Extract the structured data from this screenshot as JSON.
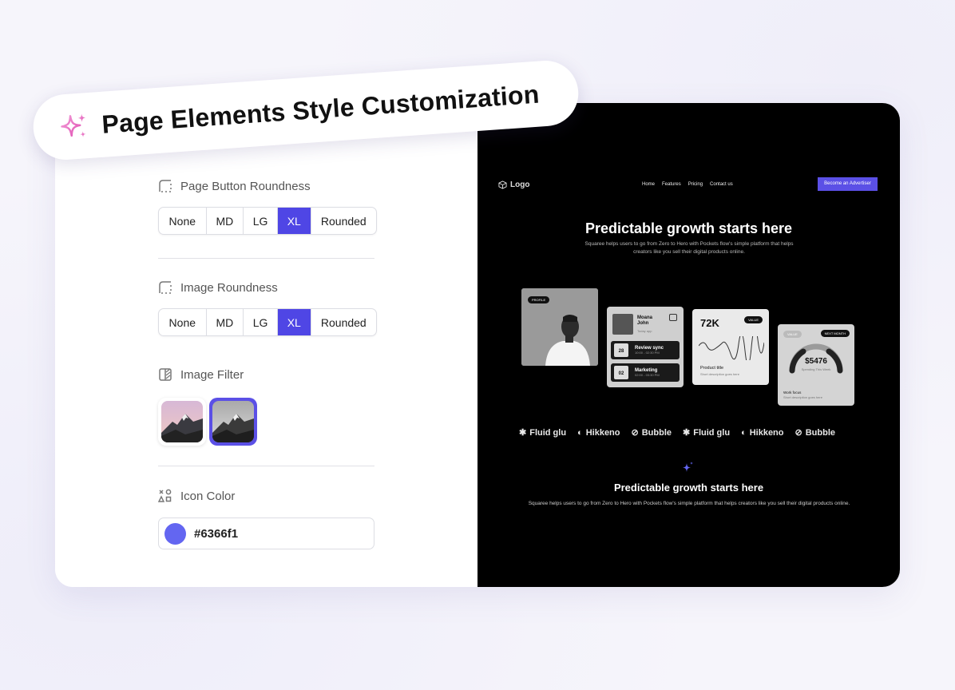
{
  "header": {
    "title": "Page Elements Style Customization",
    "icon": "sparkle-icon"
  },
  "settings": {
    "button_roundness": {
      "label": "Page Button Roundness",
      "options": [
        "None",
        "MD",
        "LG",
        "XL",
        "Rounded"
      ],
      "selected": "XL"
    },
    "image_roundness": {
      "label": "Image Roundness",
      "options": [
        "None",
        "MD",
        "LG",
        "XL",
        "Rounded"
      ],
      "selected": "XL"
    },
    "image_filter": {
      "label": "Image Filter",
      "options": [
        "color",
        "grayscale"
      ],
      "selected": "grayscale"
    },
    "icon_color": {
      "label": "Icon Color",
      "value": "#6366f1"
    }
  },
  "preview": {
    "logo": "Logo",
    "nav_links": [
      "Home",
      "Features",
      "Pricing",
      "Contact us"
    ],
    "cta": "Become an Advertiser",
    "hero_title": "Predictable growth starts here",
    "hero_sub": "Squaree helps users to go from Zero to Hero with Pockets flow's simple platform that helps creators like you sell their digital products online.",
    "profile_tag": "PROFILE",
    "schedule": {
      "name": "Moana John",
      "meta": "Today app",
      "items": [
        {
          "date": "28",
          "title": "Review sync",
          "time": "10:00 - 02:30 PM"
        },
        {
          "date": "02",
          "title": "Marketing",
          "time": "02:00 - 03:30 PM"
        }
      ]
    },
    "stat": {
      "value": "72K",
      "tag": "VALUE",
      "title": "Product title",
      "desc": "Short description goes here"
    },
    "gauge": {
      "tag": "VALUE",
      "button": "NEXT MONTH",
      "value": "$5476",
      "caption": "Spending This Week",
      "title": "Work focus",
      "desc": "Short description goes here"
    },
    "logos": [
      "Fluid glu",
      "Hikkeno",
      "Bubble",
      "Fluid glu",
      "Hikkeno",
      "Bubble"
    ],
    "section_title": "Predictable growth starts here",
    "section_sub": "Squaree helps users to go from Zero to Hero with Pockets flow's simple platform that helps creators like you sell their digital products online."
  }
}
